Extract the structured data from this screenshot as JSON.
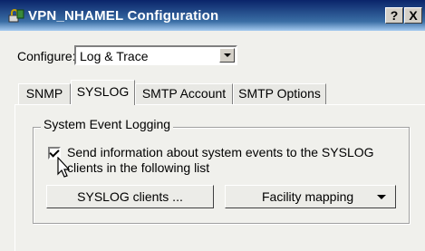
{
  "window": {
    "title": "VPN_NHAMEL Configuration",
    "help_label": "?",
    "close_label": "X"
  },
  "configure": {
    "label": "Configure:",
    "value": "Log & Trace"
  },
  "tabs": [
    {
      "label": "SNMP"
    },
    {
      "label": "SYSLOG"
    },
    {
      "label": "SMTP Account"
    },
    {
      "label": "SMTP Options"
    }
  ],
  "group": {
    "label": "System Event Logging",
    "checkbox_label": "Send information about system events to the SYSLOG clients in the following list",
    "checked": true
  },
  "buttons": {
    "syslog_clients": "SYSLOG clients ...",
    "facility_mapping": "Facility mapping"
  },
  "colors": {
    "titlebar": "#0a246a",
    "face": "#f0f0ec"
  }
}
